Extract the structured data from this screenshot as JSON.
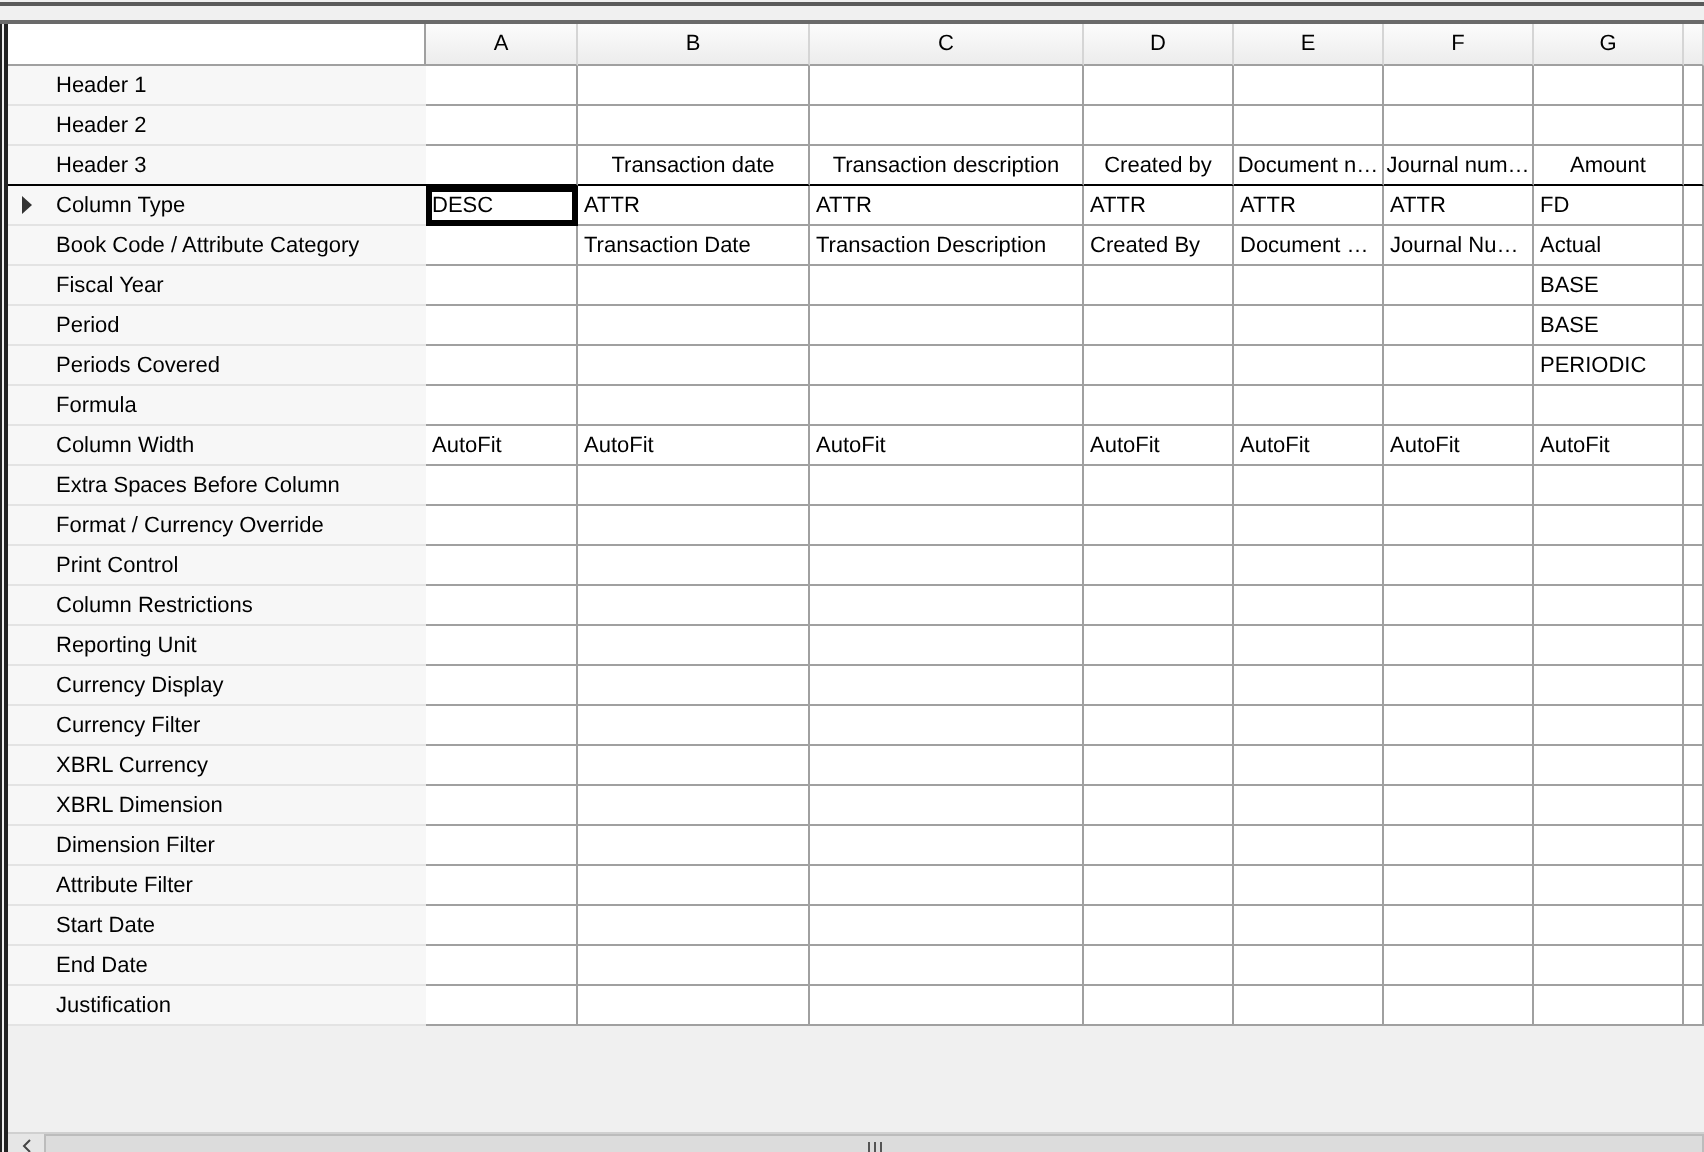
{
  "columns": [
    "A",
    "B",
    "C",
    "D",
    "E",
    "F",
    "G"
  ],
  "rows": [
    {
      "label": "Header 1",
      "kind": "header",
      "selected": false,
      "cells": [
        {
          "selected": false
        },
        {
          "selected": false
        },
        {
          "selected": false
        },
        {
          "selected": false
        },
        {
          "selected": false
        },
        {
          "selected": false
        },
        {
          "selected": false
        }
      ]
    },
    {
      "label": "Header 2",
      "kind": "header",
      "selected": false,
      "cells": [
        {
          "selected": false
        },
        {
          "selected": false
        },
        {
          "selected": false
        },
        {
          "selected": false
        },
        {
          "selected": false
        },
        {
          "selected": false
        },
        {
          "selected": false
        }
      ]
    },
    {
      "label": "Header 3",
      "kind": "header",
      "selected": false,
      "cells": [
        {
          "selected": false
        },
        {
          "text": "Transaction date",
          "selected": false
        },
        {
          "text": "Transaction description",
          "selected": false
        },
        {
          "text": "Created by",
          "selected": false
        },
        {
          "text": "Document n…",
          "selected": false
        },
        {
          "text": "Journal num…",
          "selected": false
        },
        {
          "text": "Amount",
          "selected": false
        }
      ]
    },
    {
      "label": "Column Type",
      "kind": "property",
      "selected": true,
      "cells": [
        {
          "text": "DESC",
          "selected": true
        },
        {
          "text": "ATTR",
          "selected": false
        },
        {
          "text": "ATTR",
          "selected": false
        },
        {
          "text": "ATTR",
          "selected": false
        },
        {
          "text": "ATTR",
          "selected": false
        },
        {
          "text": "ATTR",
          "selected": false
        },
        {
          "text": "FD",
          "selected": false
        }
      ]
    },
    {
      "label": "Book Code / Attribute Category",
      "kind": "property",
      "selected": false,
      "cells": [
        {
          "selected": false
        },
        {
          "text": "Transaction Date",
          "selected": false
        },
        {
          "text": "Transaction Description",
          "selected": false
        },
        {
          "text": "Created By",
          "selected": false
        },
        {
          "text": "Document …",
          "selected": false
        },
        {
          "text": "Journal Nu…",
          "selected": false
        },
        {
          "text": "Actual",
          "selected": false
        }
      ]
    },
    {
      "label": "Fiscal Year",
      "kind": "property",
      "selected": false,
      "cells": [
        {
          "selected": false
        },
        {
          "selected": false
        },
        {
          "selected": false
        },
        {
          "selected": false
        },
        {
          "selected": false
        },
        {
          "selected": false
        },
        {
          "text": "BASE",
          "selected": false
        }
      ]
    },
    {
      "label": "Period",
      "kind": "property",
      "selected": false,
      "cells": [
        {
          "selected": false
        },
        {
          "selected": false
        },
        {
          "selected": false
        },
        {
          "selected": false
        },
        {
          "selected": false
        },
        {
          "selected": false
        },
        {
          "text": "BASE",
          "selected": false
        }
      ]
    },
    {
      "label": "Periods Covered",
      "kind": "property",
      "selected": false,
      "cells": [
        {
          "selected": false
        },
        {
          "selected": false
        },
        {
          "selected": false
        },
        {
          "selected": false
        },
        {
          "selected": false
        },
        {
          "selected": false
        },
        {
          "text": "PERIODIC",
          "selected": false
        }
      ]
    },
    {
      "label": "Formula",
      "kind": "property",
      "selected": false,
      "cells": [
        {
          "selected": false
        },
        {
          "selected": false
        },
        {
          "selected": false
        },
        {
          "selected": false
        },
        {
          "selected": false
        },
        {
          "selected": false
        },
        {
          "selected": false
        }
      ]
    },
    {
      "label": "Column Width",
      "kind": "property",
      "selected": false,
      "cells": [
        {
          "text": "AutoFit",
          "selected": false
        },
        {
          "text": "AutoFit",
          "selected": false
        },
        {
          "text": "AutoFit",
          "selected": false
        },
        {
          "text": "AutoFit",
          "selected": false
        },
        {
          "text": "AutoFit",
          "selected": false
        },
        {
          "text": "AutoFit",
          "selected": false
        },
        {
          "text": "AutoFit",
          "selected": false
        }
      ]
    },
    {
      "label": "Extra Spaces Before Column",
      "kind": "property",
      "selected": false,
      "cells": [
        {
          "selected": false
        },
        {
          "selected": false
        },
        {
          "selected": false
        },
        {
          "selected": false
        },
        {
          "selected": false
        },
        {
          "selected": false
        },
        {
          "selected": false
        }
      ]
    },
    {
      "label": "Format / Currency Override",
      "kind": "property",
      "selected": false,
      "cells": [
        {
          "selected": false
        },
        {
          "selected": false
        },
        {
          "selected": false
        },
        {
          "selected": false
        },
        {
          "selected": false
        },
        {
          "selected": false
        },
        {
          "selected": false
        }
      ]
    },
    {
      "label": "Print Control",
      "kind": "property",
      "selected": false,
      "cells": [
        {
          "selected": false
        },
        {
          "selected": false
        },
        {
          "selected": false
        },
        {
          "selected": false
        },
        {
          "selected": false
        },
        {
          "selected": false
        },
        {
          "selected": false
        }
      ]
    },
    {
      "label": "Column Restrictions",
      "kind": "property",
      "selected": false,
      "cells": [
        {
          "selected": false
        },
        {
          "selected": false
        },
        {
          "selected": false
        },
        {
          "selected": false
        },
        {
          "selected": false
        },
        {
          "selected": false
        },
        {
          "selected": false
        }
      ]
    },
    {
      "label": "Reporting Unit",
      "kind": "property",
      "selected": false,
      "cells": [
        {
          "selected": false
        },
        {
          "selected": false
        },
        {
          "selected": false
        },
        {
          "selected": false
        },
        {
          "selected": false
        },
        {
          "selected": false
        },
        {
          "selected": false
        }
      ]
    },
    {
      "label": "Currency Display",
      "kind": "property",
      "selected": false,
      "cells": [
        {
          "selected": false
        },
        {
          "selected": false
        },
        {
          "selected": false
        },
        {
          "selected": false
        },
        {
          "selected": false
        },
        {
          "selected": false
        },
        {
          "selected": false
        }
      ]
    },
    {
      "label": "Currency Filter",
      "kind": "property",
      "selected": false,
      "cells": [
        {
          "selected": false
        },
        {
          "selected": false
        },
        {
          "selected": false
        },
        {
          "selected": false
        },
        {
          "selected": false
        },
        {
          "selected": false
        },
        {
          "selected": false
        }
      ]
    },
    {
      "label": "XBRL Currency",
      "kind": "property",
      "selected": false,
      "cells": [
        {
          "selected": false
        },
        {
          "selected": false
        },
        {
          "selected": false
        },
        {
          "selected": false
        },
        {
          "selected": false
        },
        {
          "selected": false
        },
        {
          "selected": false
        }
      ]
    },
    {
      "label": "XBRL Dimension",
      "kind": "property",
      "selected": false,
      "cells": [
        {
          "selected": false
        },
        {
          "selected": false
        },
        {
          "selected": false
        },
        {
          "selected": false
        },
        {
          "selected": false
        },
        {
          "selected": false
        },
        {
          "selected": false
        }
      ]
    },
    {
      "label": "Dimension Filter",
      "kind": "property",
      "selected": false,
      "cells": [
        {
          "selected": false
        },
        {
          "selected": false
        },
        {
          "selected": false
        },
        {
          "selected": false
        },
        {
          "selected": false
        },
        {
          "selected": false
        },
        {
          "selected": false
        }
      ]
    },
    {
      "label": "Attribute Filter",
      "kind": "property",
      "selected": false,
      "cells": [
        {
          "selected": false
        },
        {
          "selected": false
        },
        {
          "selected": false
        },
        {
          "selected": false
        },
        {
          "selected": false
        },
        {
          "selected": false
        },
        {
          "selected": false
        }
      ]
    },
    {
      "label": "Start Date",
      "kind": "property",
      "selected": false,
      "cells": [
        {
          "selected": false
        },
        {
          "selected": false
        },
        {
          "selected": false
        },
        {
          "selected": false
        },
        {
          "selected": false
        },
        {
          "selected": false
        },
        {
          "selected": false
        }
      ]
    },
    {
      "label": "End Date",
      "kind": "property",
      "selected": false,
      "cells": [
        {
          "selected": false
        },
        {
          "selected": false
        },
        {
          "selected": false
        },
        {
          "selected": false
        },
        {
          "selected": false
        },
        {
          "selected": false
        },
        {
          "selected": false
        }
      ]
    },
    {
      "label": "Justification",
      "kind": "property",
      "selected": false,
      "cells": [
        {
          "selected": false
        },
        {
          "selected": false
        },
        {
          "selected": false
        },
        {
          "selected": false
        },
        {
          "selected": false
        },
        {
          "selected": false
        },
        {
          "selected": false
        }
      ]
    }
  ]
}
